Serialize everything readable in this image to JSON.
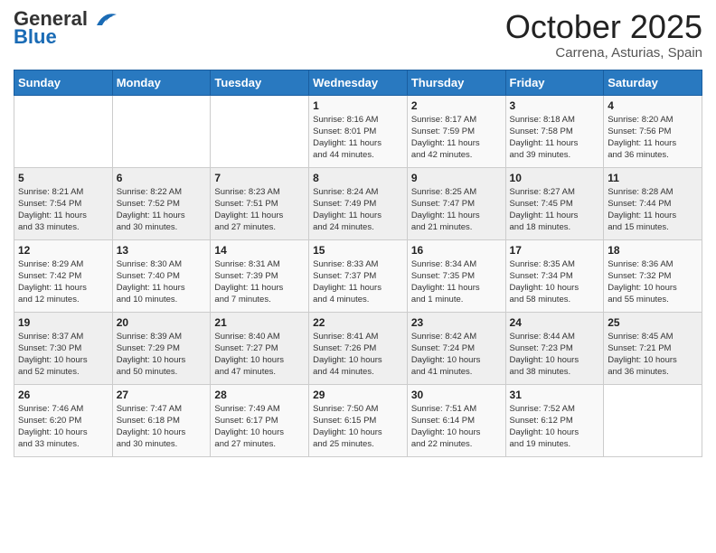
{
  "logo": {
    "text_general": "General",
    "text_blue": "Blue"
  },
  "title": "October 2025",
  "location": "Carrena, Asturias, Spain",
  "days_of_week": [
    "Sunday",
    "Monday",
    "Tuesday",
    "Wednesday",
    "Thursday",
    "Friday",
    "Saturday"
  ],
  "weeks": [
    [
      {
        "day": "",
        "info": ""
      },
      {
        "day": "",
        "info": ""
      },
      {
        "day": "",
        "info": ""
      },
      {
        "day": "1",
        "info": "Sunrise: 8:16 AM\nSunset: 8:01 PM\nDaylight: 11 hours\nand 44 minutes."
      },
      {
        "day": "2",
        "info": "Sunrise: 8:17 AM\nSunset: 7:59 PM\nDaylight: 11 hours\nand 42 minutes."
      },
      {
        "day": "3",
        "info": "Sunrise: 8:18 AM\nSunset: 7:58 PM\nDaylight: 11 hours\nand 39 minutes."
      },
      {
        "day": "4",
        "info": "Sunrise: 8:20 AM\nSunset: 7:56 PM\nDaylight: 11 hours\nand 36 minutes."
      }
    ],
    [
      {
        "day": "5",
        "info": "Sunrise: 8:21 AM\nSunset: 7:54 PM\nDaylight: 11 hours\nand 33 minutes."
      },
      {
        "day": "6",
        "info": "Sunrise: 8:22 AM\nSunset: 7:52 PM\nDaylight: 11 hours\nand 30 minutes."
      },
      {
        "day": "7",
        "info": "Sunrise: 8:23 AM\nSunset: 7:51 PM\nDaylight: 11 hours\nand 27 minutes."
      },
      {
        "day": "8",
        "info": "Sunrise: 8:24 AM\nSunset: 7:49 PM\nDaylight: 11 hours\nand 24 minutes."
      },
      {
        "day": "9",
        "info": "Sunrise: 8:25 AM\nSunset: 7:47 PM\nDaylight: 11 hours\nand 21 minutes."
      },
      {
        "day": "10",
        "info": "Sunrise: 8:27 AM\nSunset: 7:45 PM\nDaylight: 11 hours\nand 18 minutes."
      },
      {
        "day": "11",
        "info": "Sunrise: 8:28 AM\nSunset: 7:44 PM\nDaylight: 11 hours\nand 15 minutes."
      }
    ],
    [
      {
        "day": "12",
        "info": "Sunrise: 8:29 AM\nSunset: 7:42 PM\nDaylight: 11 hours\nand 12 minutes."
      },
      {
        "day": "13",
        "info": "Sunrise: 8:30 AM\nSunset: 7:40 PM\nDaylight: 11 hours\nand 10 minutes."
      },
      {
        "day": "14",
        "info": "Sunrise: 8:31 AM\nSunset: 7:39 PM\nDaylight: 11 hours\nand 7 minutes."
      },
      {
        "day": "15",
        "info": "Sunrise: 8:33 AM\nSunset: 7:37 PM\nDaylight: 11 hours\nand 4 minutes."
      },
      {
        "day": "16",
        "info": "Sunrise: 8:34 AM\nSunset: 7:35 PM\nDaylight: 11 hours\nand 1 minute."
      },
      {
        "day": "17",
        "info": "Sunrise: 8:35 AM\nSunset: 7:34 PM\nDaylight: 10 hours\nand 58 minutes."
      },
      {
        "day": "18",
        "info": "Sunrise: 8:36 AM\nSunset: 7:32 PM\nDaylight: 10 hours\nand 55 minutes."
      }
    ],
    [
      {
        "day": "19",
        "info": "Sunrise: 8:37 AM\nSunset: 7:30 PM\nDaylight: 10 hours\nand 52 minutes."
      },
      {
        "day": "20",
        "info": "Sunrise: 8:39 AM\nSunset: 7:29 PM\nDaylight: 10 hours\nand 50 minutes."
      },
      {
        "day": "21",
        "info": "Sunrise: 8:40 AM\nSunset: 7:27 PM\nDaylight: 10 hours\nand 47 minutes."
      },
      {
        "day": "22",
        "info": "Sunrise: 8:41 AM\nSunset: 7:26 PM\nDaylight: 10 hours\nand 44 minutes."
      },
      {
        "day": "23",
        "info": "Sunrise: 8:42 AM\nSunset: 7:24 PM\nDaylight: 10 hours\nand 41 minutes."
      },
      {
        "day": "24",
        "info": "Sunrise: 8:44 AM\nSunset: 7:23 PM\nDaylight: 10 hours\nand 38 minutes."
      },
      {
        "day": "25",
        "info": "Sunrise: 8:45 AM\nSunset: 7:21 PM\nDaylight: 10 hours\nand 36 minutes."
      }
    ],
    [
      {
        "day": "26",
        "info": "Sunrise: 7:46 AM\nSunset: 6:20 PM\nDaylight: 10 hours\nand 33 minutes."
      },
      {
        "day": "27",
        "info": "Sunrise: 7:47 AM\nSunset: 6:18 PM\nDaylight: 10 hours\nand 30 minutes."
      },
      {
        "day": "28",
        "info": "Sunrise: 7:49 AM\nSunset: 6:17 PM\nDaylight: 10 hours\nand 27 minutes."
      },
      {
        "day": "29",
        "info": "Sunrise: 7:50 AM\nSunset: 6:15 PM\nDaylight: 10 hours\nand 25 minutes."
      },
      {
        "day": "30",
        "info": "Sunrise: 7:51 AM\nSunset: 6:14 PM\nDaylight: 10 hours\nand 22 minutes."
      },
      {
        "day": "31",
        "info": "Sunrise: 7:52 AM\nSunset: 6:12 PM\nDaylight: 10 hours\nand 19 minutes."
      },
      {
        "day": "",
        "info": ""
      }
    ]
  ]
}
